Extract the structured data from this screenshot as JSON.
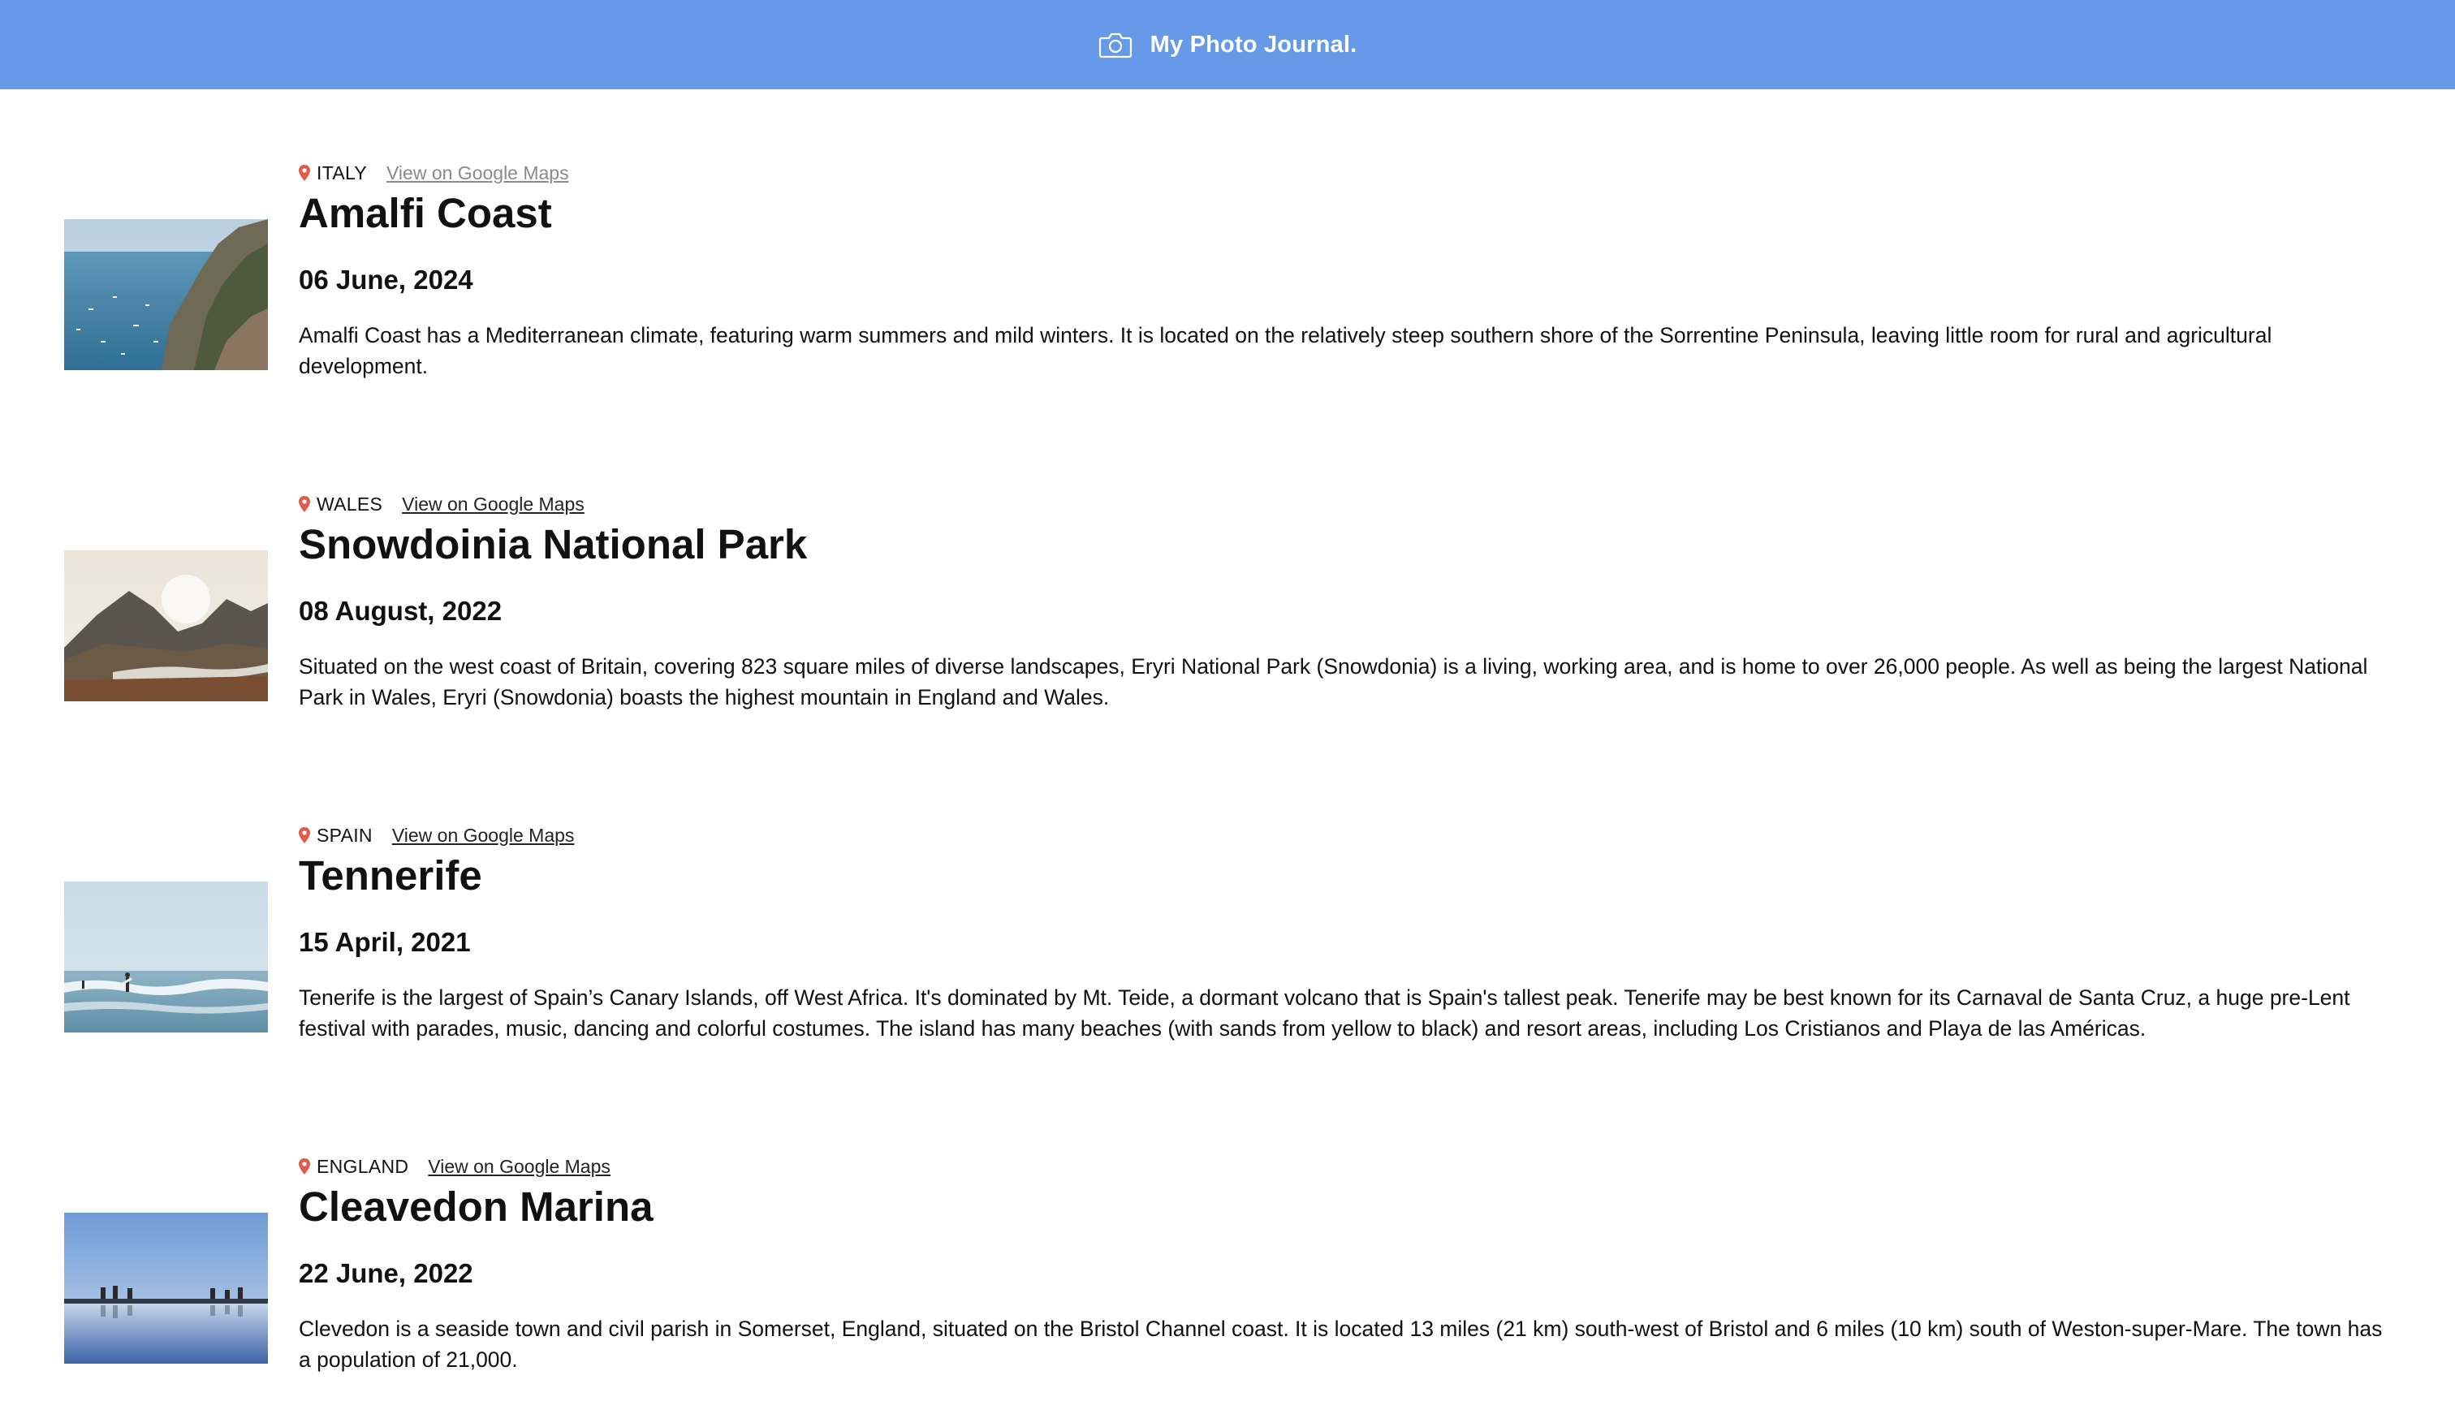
{
  "header": {
    "title": "My Photo Journal.",
    "icon": "camera-icon",
    "background_color": "#6699e8"
  },
  "entries": [
    {
      "country": "ITALY",
      "maps_link_label": "View on Google Maps",
      "maps_link_visited": true,
      "place": "Amalfi Coast",
      "date": "06 June, 2024",
      "description": "Amalfi Coast has a Mediterranean climate, featuring warm summers and mild winters. It is located on the relatively steep southern shore of the Sorrentine Peninsula, leaving little room for rural and agricultural development.",
      "photo": "amalfi-coast-photo"
    },
    {
      "country": "WALES",
      "maps_link_label": "View on Google Maps",
      "maps_link_visited": false,
      "place": "Snowdoinia National Park",
      "date": "08 August, 2022",
      "description": "Situated on the west coast of Britain, covering 823 square miles of diverse landscapes, Eryri National Park (Snowdonia) is a living, working area, and is home to over 26,000 people. As well as being the largest National Park in Wales, Eryri (Snowdonia) boasts the highest mountain in England and Wales.",
      "photo": "snowdonia-photo"
    },
    {
      "country": "SPAIN",
      "maps_link_label": "View on Google Maps",
      "maps_link_visited": false,
      "place": "Tennerife",
      "date": "15 April, 2021",
      "description": "Tenerife is the largest of Spain’s Canary Islands, off West Africa. It's dominated by Mt. Teide, a dormant volcano that is Spain's tallest peak. Tenerife may be best known for its Carnaval de Santa Cruz, a huge pre-Lent festival with parades, music, dancing and colorful costumes. The island has many beaches (with sands from yellow to black) and resort areas, including Los Cristianos and Playa de las Américas.",
      "photo": "tenerife-photo"
    },
    {
      "country": "ENGLAND",
      "maps_link_label": "View on Google Maps",
      "maps_link_visited": false,
      "place": "Cleavedon Marina",
      "date": "22 June, 2022",
      "description": "Clevedon is a seaside town and civil parish in Somerset, England, situated on the Bristol Channel coast. It is located 13 miles (21 km) south-west of Bristol and 6 miles (10 km) south of Weston-super-Mare. The town has a population of 21,000.",
      "photo": "clevedon-photo"
    }
  ],
  "colors": {
    "pin": "#e05a4e",
    "link": "#222222",
    "visited_link": "#8a8a8a"
  }
}
